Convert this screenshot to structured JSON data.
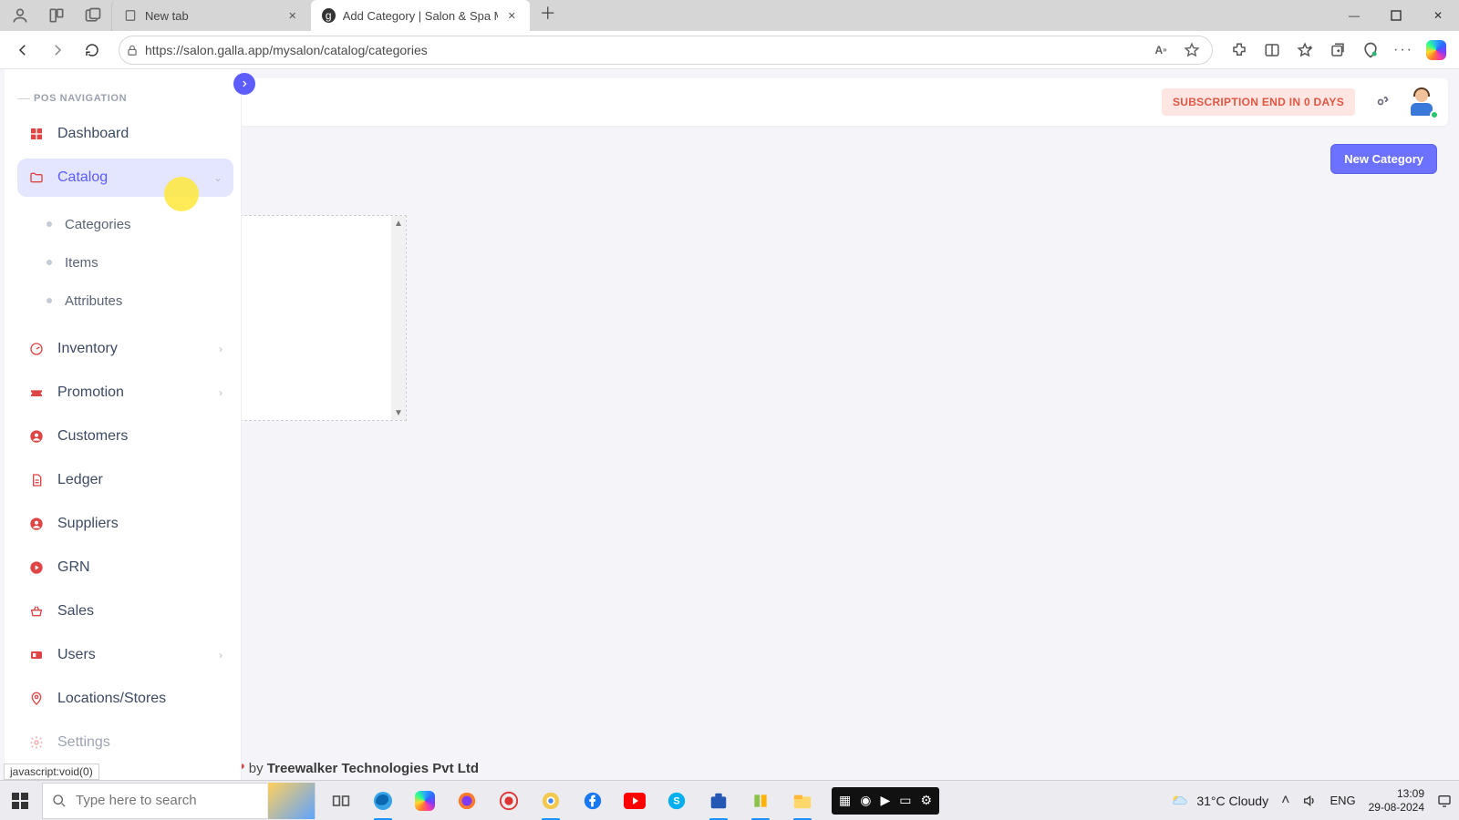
{
  "browser": {
    "tabs": [
      {
        "title": "New tab",
        "active": false
      },
      {
        "title": "Add Category | Salon & Spa Mana",
        "active": true
      }
    ],
    "url": "https://salon.galla.app/mysalon/catalog/categories",
    "status_hover_text": "javascript:void(0)"
  },
  "app": {
    "subscription_badge": "SUBSCRIPTION END IN 0 DAYS",
    "action_button": "New Category",
    "footer_prefix": "by ",
    "footer_company": "Treewalker Technologies Pvt Ltd"
  },
  "sidebar": {
    "heading": "POS NAVIGATION",
    "items": [
      {
        "label": "Dashboard",
        "icon": "dashboard-icon",
        "expandable": false
      },
      {
        "label": "Catalog",
        "icon": "folder-icon",
        "expandable": true,
        "active": true,
        "children": [
          {
            "label": "Categories"
          },
          {
            "label": "Items"
          },
          {
            "label": "Attributes"
          }
        ]
      },
      {
        "label": "Inventory",
        "icon": "gauge-icon",
        "expandable": true
      },
      {
        "label": "Promotion",
        "icon": "ticket-icon",
        "expandable": true
      },
      {
        "label": "Customers",
        "icon": "user-circle-icon"
      },
      {
        "label": "Ledger",
        "icon": "file-icon"
      },
      {
        "label": "Suppliers",
        "icon": "user-circle-icon"
      },
      {
        "label": "GRN",
        "icon": "play-circle-icon"
      },
      {
        "label": "Sales",
        "icon": "basket-icon"
      },
      {
        "label": "Users",
        "icon": "card-icon",
        "expandable": true
      },
      {
        "label": "Locations/Stores",
        "icon": "pin-icon"
      },
      {
        "label": "Settings",
        "icon": "gear-icon"
      }
    ]
  },
  "taskbar": {
    "search_placeholder": "Type here to search",
    "weather_text": "31°C  Cloudy",
    "lang": "ENG",
    "time": "13:09",
    "date": "29-08-2024"
  }
}
